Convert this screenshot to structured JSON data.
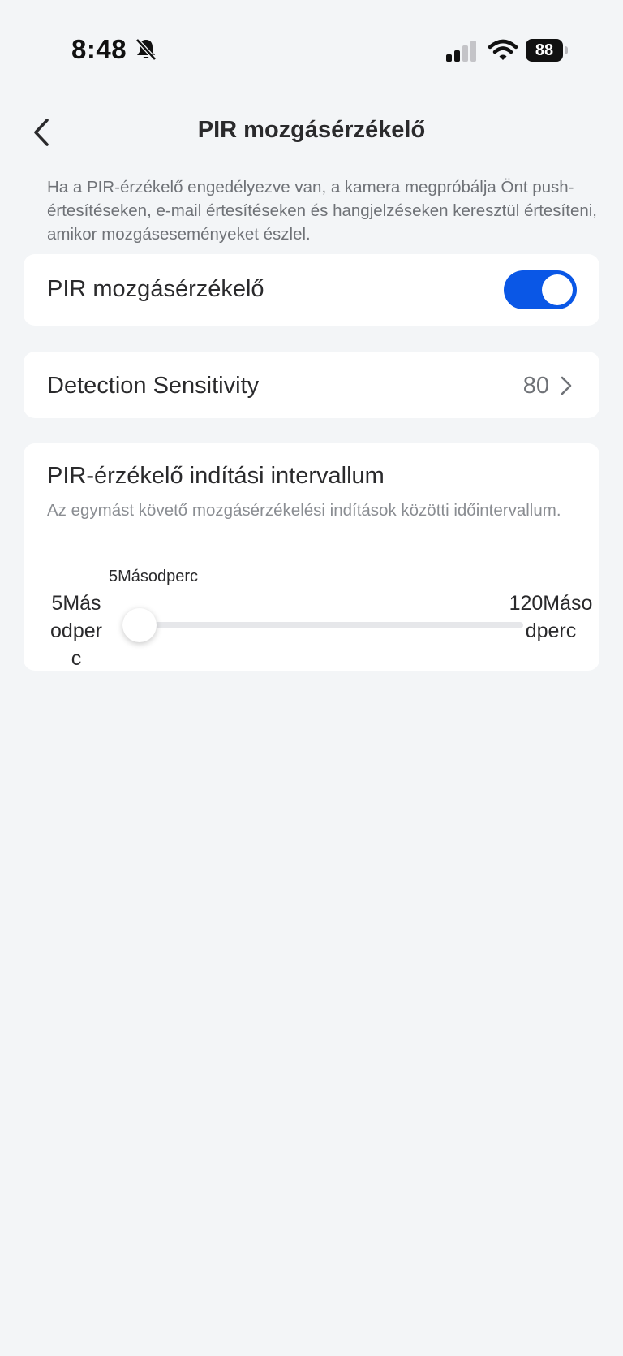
{
  "status_bar": {
    "time": "8:48",
    "silent_icon": "bell-slash-icon",
    "signal_icon": "cellular-signal-icon",
    "wifi_icon": "wifi-icon",
    "battery_level": "88"
  },
  "nav": {
    "back_icon": "chevron-left-icon",
    "title": "PIR mozgásérzékelő"
  },
  "intro_text": "Ha a PIR-érzékelő engedélyezve van, a kamera megpróbálja Önt push-értesítéseken, e-mail értesítéseken és hangjelzéseken keresztül értesíteni, amikor mozgáseseményeket észlel.",
  "pir_row": {
    "label": "PIR mozgásérzékelő",
    "enabled": true
  },
  "sensitivity_row": {
    "label": "Detection Sensitivity",
    "value": "80"
  },
  "interval": {
    "title": "PIR-érzékelő indítási intervallum",
    "description": "Az egymást követő mozgásérzékelési indítások közötti időintervallum.",
    "current_label": "5Másodperc",
    "min_label": "5Másodperc",
    "max_label": "120Másodperc",
    "min": 5,
    "max": 120,
    "value": 5
  },
  "colors": {
    "accent": "#0a57e6",
    "background": "#f3f5f7",
    "card": "#ffffff"
  }
}
